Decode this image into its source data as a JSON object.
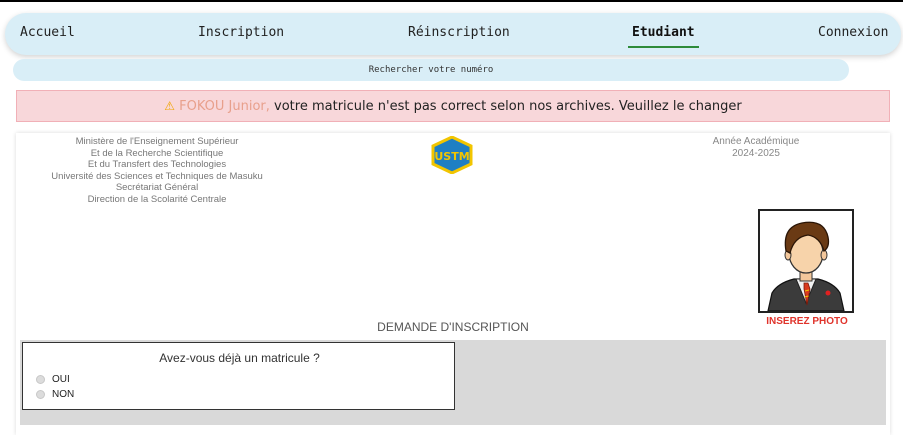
{
  "nav": {
    "items": [
      {
        "label": "Accueil"
      },
      {
        "label": "Inscription"
      },
      {
        "label": "Réinscription"
      },
      {
        "label": "Etudiant"
      },
      {
        "label": "Connexion"
      }
    ],
    "active": "Etudiant",
    "accent": "#2e8b3a",
    "background": "#d9eef7"
  },
  "search": {
    "label": "Rechercher votre numéro"
  },
  "alert": {
    "icon": "warning-icon",
    "name": "FOKOU Junior,",
    "message": "votre matricule n'est pas correct selon nos archives. Veuillez le changer",
    "background": "#f8d7da"
  },
  "header": {
    "ministry": [
      "Ministère de l'Enseignement Supérieur",
      "Et de la Recherche Scientifique",
      "Et du Transfert des Technologies",
      "Université des Sciences et Techniques de Masuku",
      "Secrétariat Général",
      "Direction de la Scolarité Centrale"
    ],
    "annee_label": "Année Académique",
    "annee_value": "2024-2025",
    "logo_text": "USTM"
  },
  "photo": {
    "label": "INSEREZ PHOTO"
  },
  "form": {
    "title": "DEMANDE D'INSCRIPTION",
    "question": "Avez-vous déjà un matricule ?",
    "options": [
      "OUI",
      "NON"
    ]
  }
}
